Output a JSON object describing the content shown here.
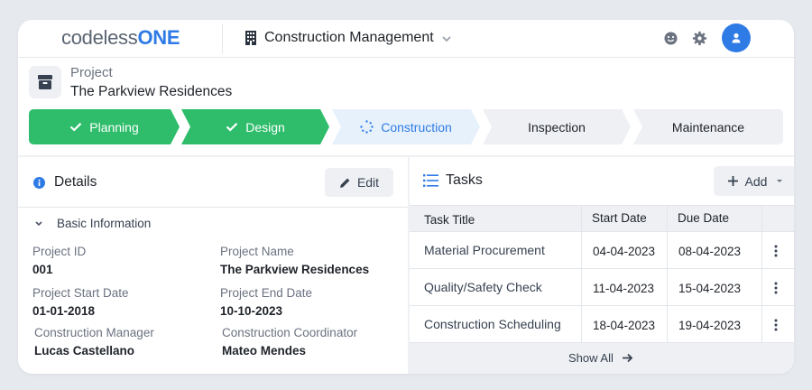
{
  "topbar": {
    "logo_part1": "codeless",
    "logo_part2": "ONE",
    "app_title": "Construction Management",
    "icons": [
      "building-icon",
      "chevron-down-icon",
      "smiley-icon",
      "gear-icon",
      "user-avatar-icon"
    ]
  },
  "project": {
    "label": "Project",
    "name": "The Parkview Residences"
  },
  "stages": [
    {
      "label": "Planning",
      "status": "done"
    },
    {
      "label": "Design",
      "status": "done"
    },
    {
      "label": "Construction",
      "status": "in-progress"
    },
    {
      "label": "Inspection",
      "status": "pending"
    },
    {
      "label": "Maintenance",
      "status": "pending"
    }
  ],
  "details": {
    "title": "Details",
    "edit_label": "Edit",
    "section_title": "Basic Information",
    "fields": [
      {
        "label": "Project ID",
        "value": "001"
      },
      {
        "label": "Project Name",
        "value": "The Parkview Residences"
      },
      {
        "label": "Project Start Date",
        "value": "01-01-2018"
      },
      {
        "label": "Project End Date",
        "value": "10-10-2023"
      },
      {
        "label": "Construction Manager",
        "value": "Lucas Castellano"
      },
      {
        "label": "Construction Coordinator",
        "value": "Mateo Mendes"
      }
    ]
  },
  "tasks": {
    "title": "Tasks",
    "add_label": "Add",
    "columns": [
      "Task Title",
      "Start Date",
      "Due Date"
    ],
    "rows": [
      {
        "title": "Material Procurement",
        "start": "04-04-2023",
        "due": "08-04-2023"
      },
      {
        "title": "Quality/Safety Check",
        "start": "11-04-2023",
        "due": "15-04-2023"
      },
      {
        "title": "Construction Scheduling",
        "start": "18-04-2023",
        "due": "19-04-2023"
      }
    ],
    "show_all_label": "Show All"
  },
  "colors": {
    "brand_blue": "#2f7be6",
    "done_green": "#2fbd6b",
    "active_bg": "#e7f1fc"
  }
}
